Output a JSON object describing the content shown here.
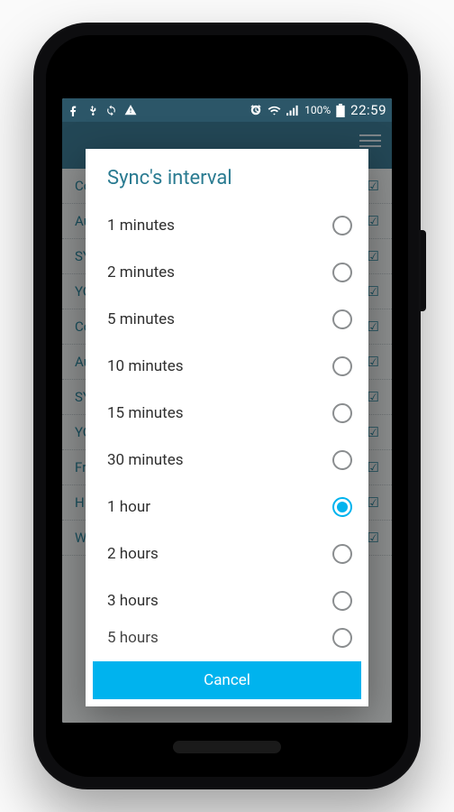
{
  "statusbar": {
    "battery_text": "100%",
    "clock": "22:59"
  },
  "dialog": {
    "title": "Sync's interval",
    "cancel_label": "Cancel",
    "selected_index": 6,
    "options": [
      {
        "label": "1 minutes"
      },
      {
        "label": "2 minutes"
      },
      {
        "label": "5 minutes"
      },
      {
        "label": "10 minutes"
      },
      {
        "label": "15 minutes"
      },
      {
        "label": "30 minutes"
      },
      {
        "label": "1 hour"
      },
      {
        "label": "2 hours"
      },
      {
        "label": "3 hours"
      },
      {
        "label": "5 hours"
      }
    ]
  },
  "background": {
    "items": [
      "Co",
      "Au",
      "SY",
      "YO",
      "Co",
      "Au",
      "SY",
      "YO",
      "Fr",
      "H",
      "W"
    ]
  }
}
